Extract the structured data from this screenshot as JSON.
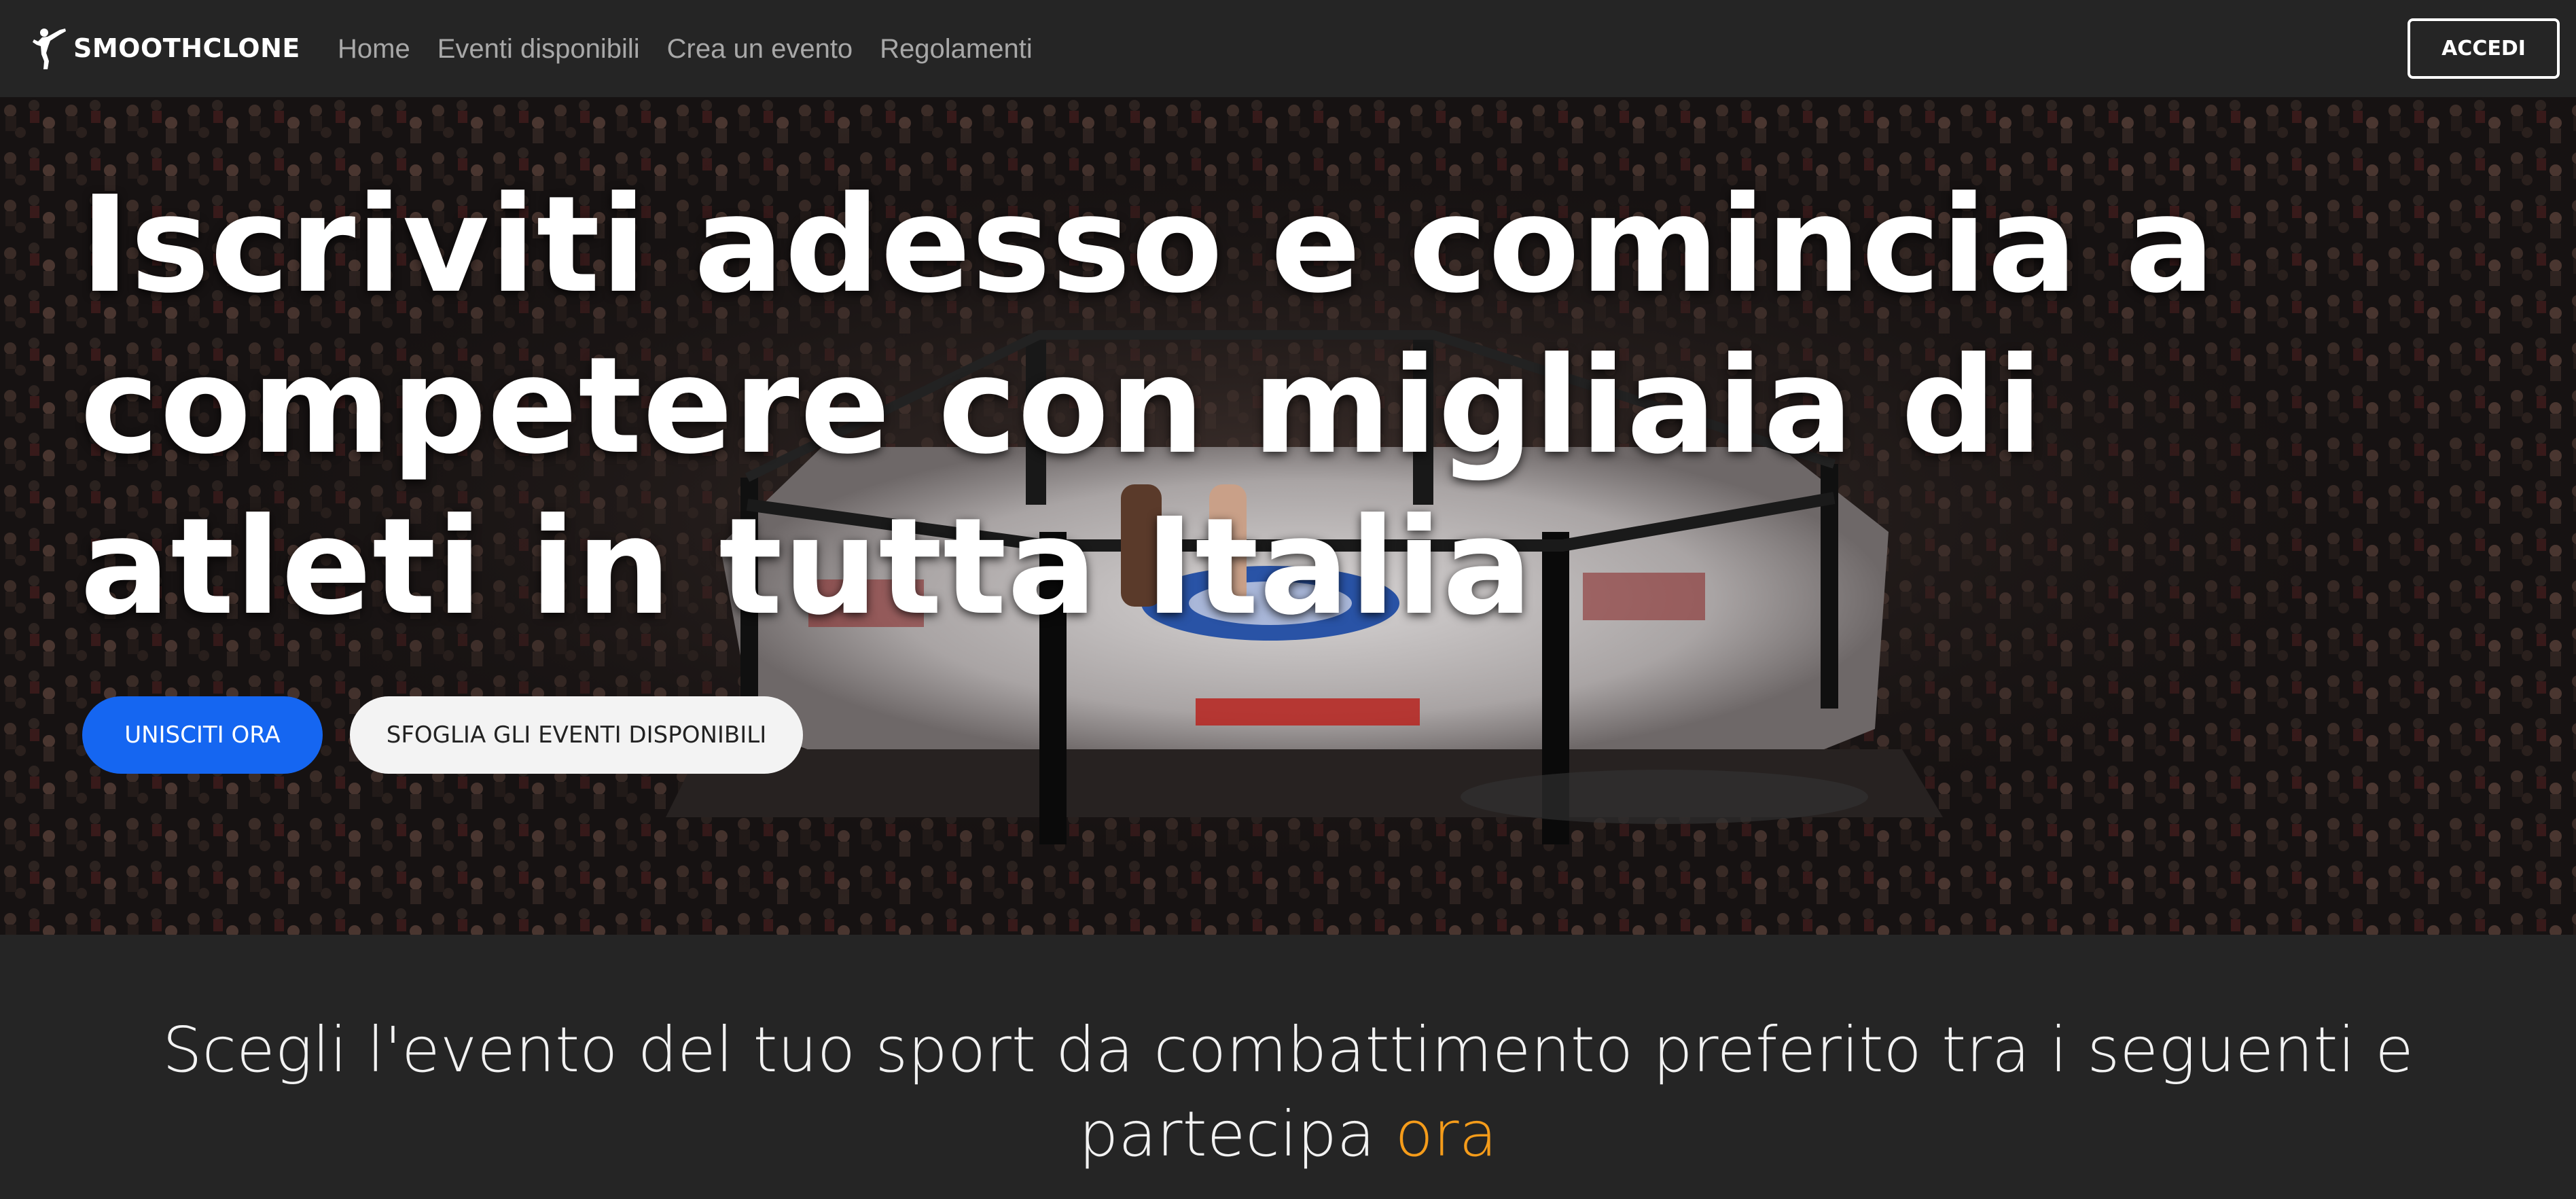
{
  "navbar": {
    "brand_name": "SMOOTHCLONE",
    "brand_icon": "karate-kick-icon",
    "links": [
      {
        "label": "Home"
      },
      {
        "label": "Eventi disponibili"
      },
      {
        "label": "Crea un evento"
      },
      {
        "label": "Regolamenti"
      }
    ],
    "login_label": "ACCEDI"
  },
  "hero": {
    "title": "Iscriviti adesso e comincia a competere con migliaia di atleti in tutta Italia",
    "background_image": "mma-octagon-arena-photo",
    "join_label": "UNISCITI ORA",
    "browse_label": "SFOGLIA GLI EVENTI DISPONIBILI"
  },
  "tagline": {
    "text": "Scegli l'evento del tuo sport da combattimento preferito tra i seguenti e partecipa ",
    "accent": "ora"
  },
  "colors": {
    "navbar_bg": "#252525",
    "primary_button": "#1566f1",
    "secondary_button": "#f3f3f3",
    "accent": "#f59c1a",
    "nav_link": "#a8a8a8"
  }
}
